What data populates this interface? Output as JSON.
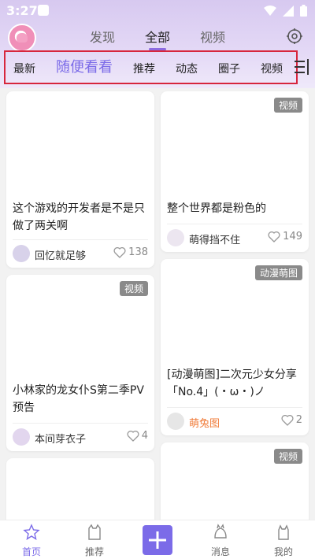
{
  "status": {
    "time": "3:27"
  },
  "top_tabs": [
    "发现",
    "全部",
    "视频"
  ],
  "categories": [
    "最新",
    "随便看看",
    "推荐",
    "动态",
    "圈子",
    "视频"
  ],
  "cards": [
    {
      "title": "这个游戏的开发者是不是只做了两关啊",
      "user": "回忆就足够",
      "likes": "138",
      "badge": ""
    },
    {
      "title": "整个世界都是粉色的",
      "user": "萌得挡不住",
      "likes": "149",
      "badge": "视频"
    },
    {
      "title": "小林家的龙女仆S第二季PV预告",
      "user": "本间芽衣子",
      "likes": "4",
      "badge": "视频"
    },
    {
      "title": "[动漫萌图]二次元少女分享「No.4」(・ω・)ノ",
      "user": "萌兔图",
      "likes": "2",
      "badge": "动漫萌图"
    },
    {
      "title": "",
      "user": "",
      "likes": "",
      "badge": "视频"
    }
  ],
  "bottom_nav": [
    "首页",
    "推荐",
    "消息",
    "我的"
  ],
  "colors": {
    "accent": "#7b6be8",
    "header": "#d7c9f0",
    "highlight_border": "#d7263d",
    "orange_user": "#f07c3a"
  }
}
